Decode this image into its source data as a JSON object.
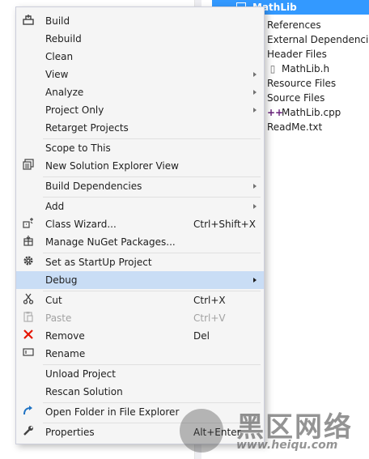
{
  "explorer": {
    "root": "MathLib",
    "items": [
      {
        "label": "References",
        "icon": "references-icon"
      },
      {
        "label": "External Dependencies",
        "icon": "folder-icon"
      },
      {
        "label": "Header Files",
        "icon": "folder-icon"
      },
      {
        "label": "MathLib.h",
        "icon": "header-file-icon"
      },
      {
        "label": "Resource Files",
        "icon": "folder-icon"
      },
      {
        "label": "Source Files",
        "icon": "folder-icon"
      },
      {
        "label": "MathLib.cpp",
        "icon": "cpp-file-icon",
        "glyph": "++"
      },
      {
        "label": "ReadMe.txt",
        "icon": "text-file-icon"
      }
    ]
  },
  "menu": {
    "build": "Build",
    "rebuild": "Rebuild",
    "clean": "Clean",
    "view": "View",
    "analyze": "Analyze",
    "project_only": "Project Only",
    "retarget": "Retarget Projects",
    "scope": "Scope to This",
    "new_view": "New Solution Explorer View",
    "build_deps": "Build Dependencies",
    "add": "Add",
    "class_wizard": "Class Wizard...",
    "class_wizard_shortcut": "Ctrl+Shift+X",
    "nuget": "Manage NuGet Packages...",
    "startup": "Set as StartUp Project",
    "debug": "Debug",
    "cut": "Cut",
    "cut_shortcut": "Ctrl+X",
    "paste": "Paste",
    "paste_shortcut": "Ctrl+V",
    "remove": "Remove",
    "remove_shortcut": "Del",
    "rename": "Rename",
    "unload": "Unload Project",
    "rescan": "Rescan Solution",
    "open_folder": "Open Folder in File Explorer",
    "properties": "Properties",
    "properties_shortcut": "Alt+Enter"
  },
  "watermark": {
    "title": "黑区网络",
    "url": "www.heiqu.com"
  },
  "colors": {
    "selection": "#3399ff",
    "hover": "#c9ddf5",
    "remove_icon": "#e51400",
    "open_folder_icon": "#1e72c3"
  }
}
